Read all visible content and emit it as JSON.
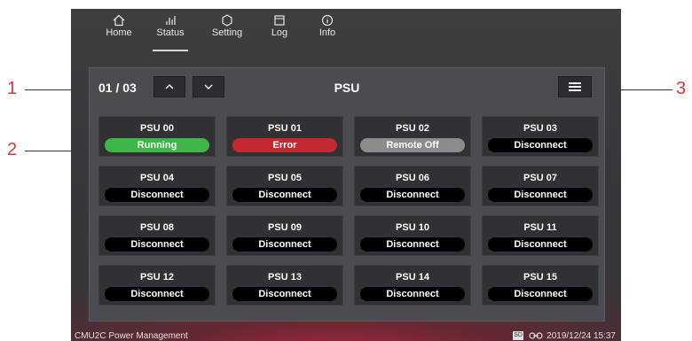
{
  "nav": {
    "items": [
      {
        "label": "Home",
        "icon": "home-icon"
      },
      {
        "label": "Status",
        "icon": "bar-chart-icon"
      },
      {
        "label": "Setting",
        "icon": "gear-icon"
      },
      {
        "label": "Log",
        "icon": "log-icon"
      },
      {
        "label": "Info",
        "icon": "info-icon"
      }
    ],
    "active": "Status"
  },
  "panel": {
    "page_indicator": "01 / 03",
    "up_label": "^",
    "down_label": "v",
    "title": "PSU"
  },
  "psus": [
    {
      "name": "PSU 00",
      "status": "Running"
    },
    {
      "name": "PSU 01",
      "status": "Error"
    },
    {
      "name": "PSU 02",
      "status": "Remote Off"
    },
    {
      "name": "PSU 03",
      "status": "Disconnect"
    },
    {
      "name": "PSU 04",
      "status": "Disconnect"
    },
    {
      "name": "PSU 05",
      "status": "Disconnect"
    },
    {
      "name": "PSU 06",
      "status": "Disconnect"
    },
    {
      "name": "PSU 07",
      "status": "Disconnect"
    },
    {
      "name": "PSU 08",
      "status": "Disconnect"
    },
    {
      "name": "PSU 09",
      "status": "Disconnect"
    },
    {
      "name": "PSU 10",
      "status": "Disconnect"
    },
    {
      "name": "PSU 11",
      "status": "Disconnect"
    },
    {
      "name": "PSU 12",
      "status": "Disconnect"
    },
    {
      "name": "PSU 13",
      "status": "Disconnect"
    },
    {
      "name": "PSU 14",
      "status": "Disconnect"
    },
    {
      "name": "PSU 15",
      "status": "Disconnect"
    }
  ],
  "status_colors": {
    "Running": "#3fb64a",
    "Error": "#c22a30",
    "Remote Off": "#8c8c8c",
    "Disconnect": "#000000"
  },
  "footer": {
    "app_name": "CMU2C Power Management",
    "sd_label": "SD",
    "datetime": "2019/12/24 15:37"
  },
  "callouts": [
    "1",
    "2",
    "3"
  ]
}
